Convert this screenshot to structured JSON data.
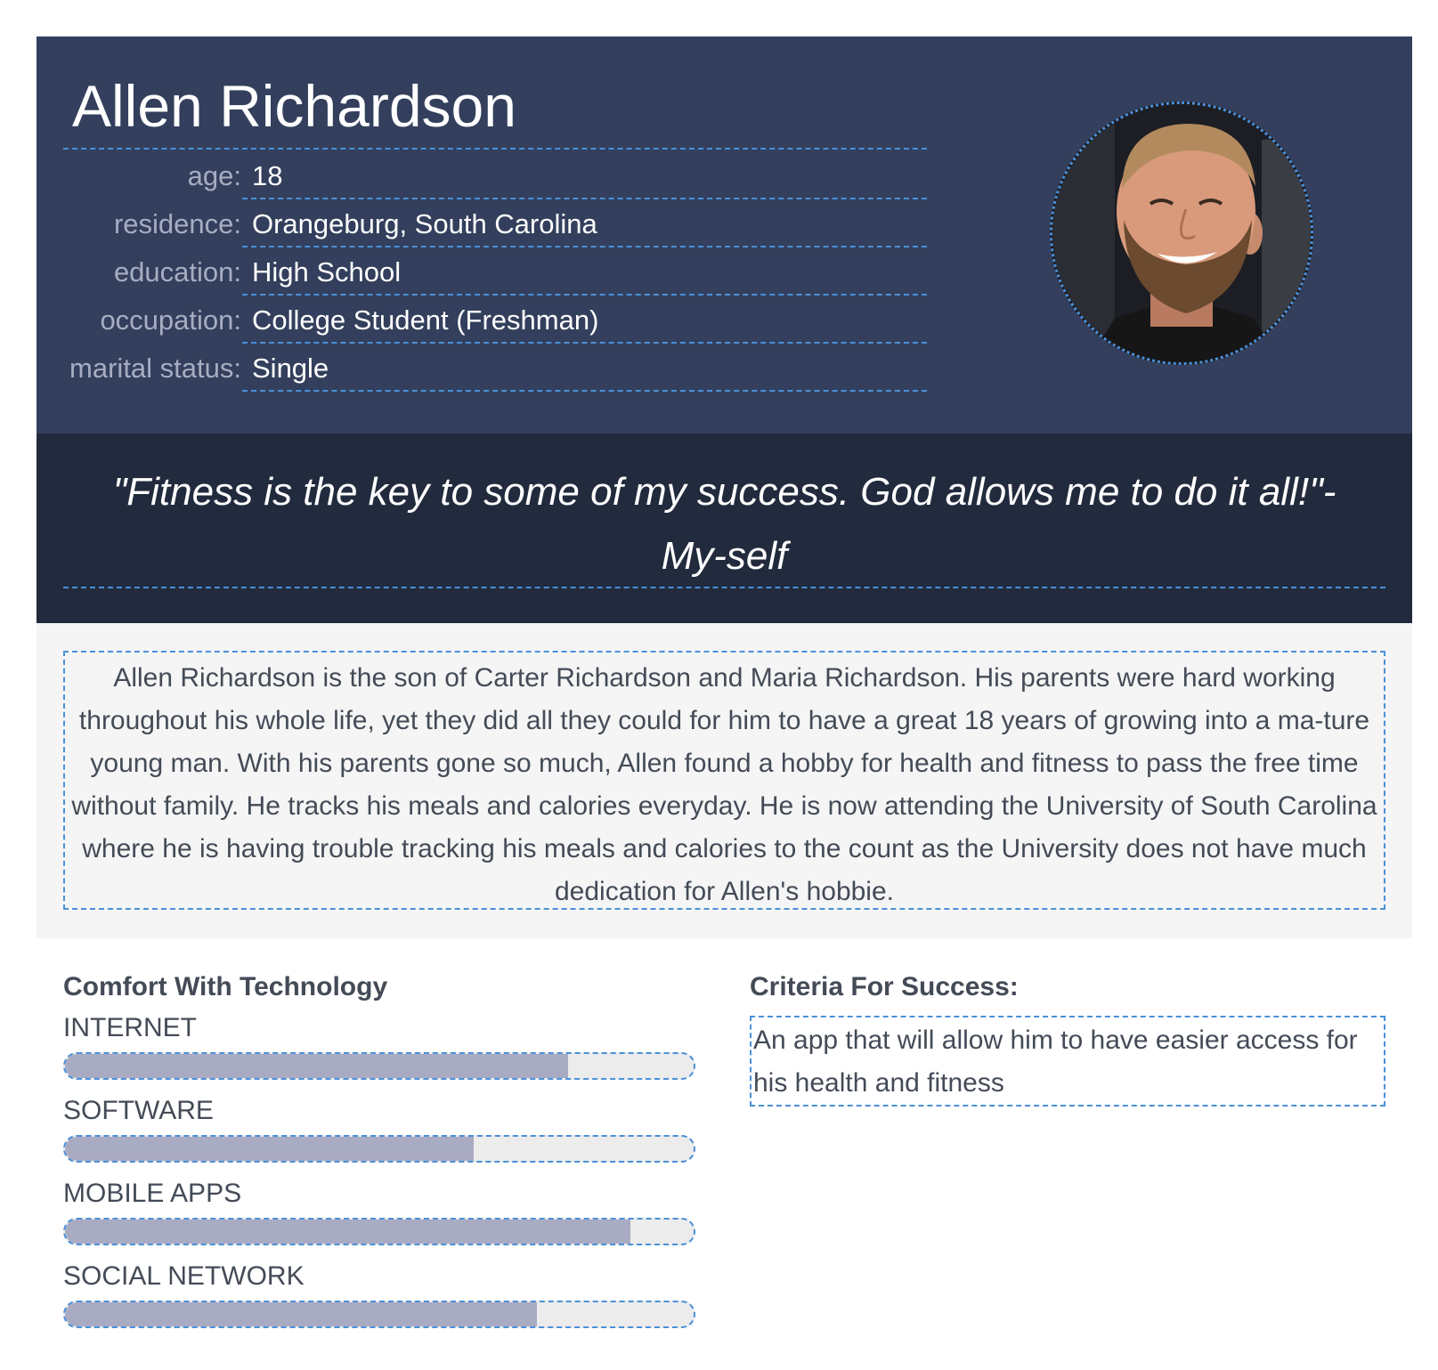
{
  "persona": {
    "name": "Allen Richardson",
    "fields": [
      {
        "label": "age:",
        "value": "18"
      },
      {
        "label": "residence:",
        "value": "Orangeburg, South Carolina"
      },
      {
        "label": "education:",
        "value": "High School"
      },
      {
        "label": "occupation:",
        "value": "College Student (Freshman)"
      },
      {
        "label": "marital status:",
        "value": "Single"
      }
    ],
    "avatar_icon": "profile-photo"
  },
  "quote": "\"Fitness is the key to some of my success. God allows me to do it all!\"- My-self",
  "bio": "Allen Richardson is the son of Carter Richardson and Maria Richardson. His parents were hard working throughout his whole life, yet they did all they could for him to have a great 18 years of growing into a ma-ture young man. With his parents gone so much, Allen found a hobby for health and fitness to pass the free time without family. He tracks his meals and calories everyday. He is now attending the University of South Carolina where he is having trouble tracking his meals and calories to the count as the University does not have much dedication for Allen's hobbie.",
  "technology": {
    "title": "Comfort With Technology",
    "items": [
      {
        "label": "INTERNET",
        "level": 0.8
      },
      {
        "label": "SOFTWARE",
        "level": 0.65
      },
      {
        "label": "MOBILE APPS",
        "level": 0.9
      },
      {
        "label": "SOCIAL NETWORK",
        "level": 0.75
      }
    ]
  },
  "criteria": {
    "title": "Criteria For Success:",
    "text": "An app that will allow him to have easier access for his health and fitness"
  },
  "colors": {
    "header_bg": "#333f5c",
    "quote_bg": "#222b3d",
    "bio_bg": "#f5f5f5",
    "accent_dashed": "#4a90d9",
    "bar_fill": "#a9abc3",
    "bar_track": "#ececec",
    "text_dark": "#444b57",
    "label_muted": "#a7adc2"
  }
}
